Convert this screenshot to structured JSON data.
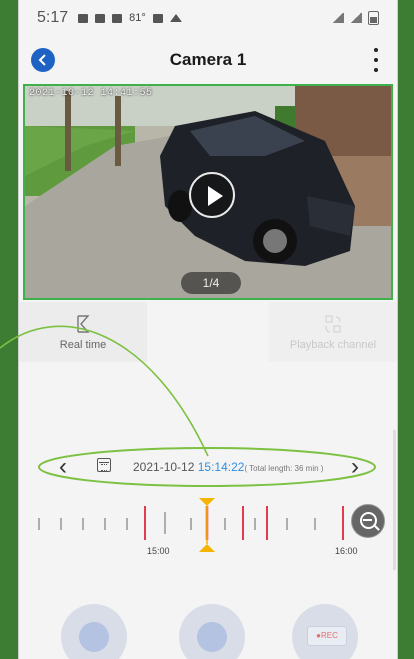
{
  "status_bar": {
    "time": "5:17",
    "temp": "81°"
  },
  "header": {
    "title": "Camera 1"
  },
  "video": {
    "timestamp_overlay": "2021-10-12 14:41:55",
    "page_indicator": "1/4"
  },
  "modes": {
    "real_time": "Real time",
    "playback": "Playback channel"
  },
  "date_bar": {
    "date": "2021-10-12 ",
    "time": "15:14:22",
    "total_length": "( Total length: 36 min )"
  },
  "timeline": {
    "labels": [
      "15:00",
      "16:00"
    ],
    "cursor_time": "15:14:22"
  },
  "colors": {
    "accent_blue": "#1e63c4",
    "highlight_green": "#7cc142",
    "marker_red": "#e23b4e",
    "cursor_yellow": "#f4b400"
  }
}
